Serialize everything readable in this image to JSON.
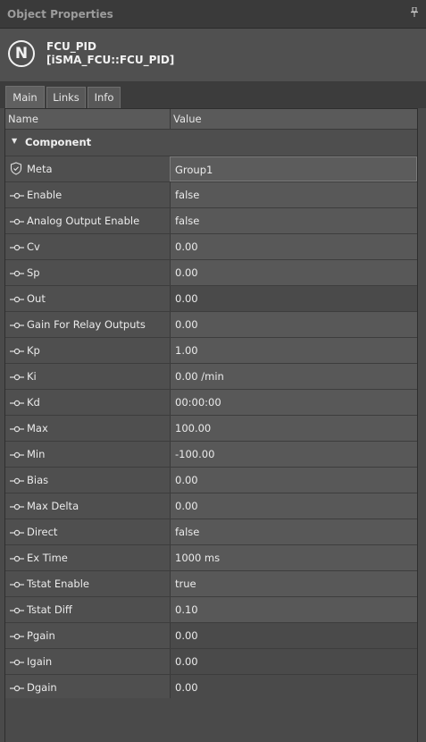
{
  "window": {
    "title": "Object Properties",
    "pin_icon": "pin-icon"
  },
  "object": {
    "name": "FCU_PID",
    "type": "[iSMA_FCU::FCU_PID]",
    "logo_letter": "N"
  },
  "tabs": [
    {
      "label": "Main",
      "active": true
    },
    {
      "label": "Links",
      "active": false
    },
    {
      "label": "Info",
      "active": false
    }
  ],
  "columns": {
    "name": "Name",
    "value": "Value"
  },
  "section": {
    "label": "Component"
  },
  "rows": [
    {
      "name": "Meta",
      "value": "Group1",
      "icon": "shield-icon"
    },
    {
      "name": "Enable",
      "value": "false",
      "icon": "slot-icon"
    },
    {
      "name": "Analog Output Enable",
      "value": "false",
      "icon": "slot-icon"
    },
    {
      "name": "Cv",
      "value": "0.00",
      "icon": "slot-icon"
    },
    {
      "name": "Sp",
      "value": "0.00",
      "icon": "slot-icon"
    },
    {
      "name": "Out",
      "value": "0.00",
      "icon": "slot-icon"
    },
    {
      "name": "Gain For Relay Outputs",
      "value": "0.00",
      "icon": "slot-icon"
    },
    {
      "name": "Kp",
      "value": "1.00",
      "icon": "slot-icon"
    },
    {
      "name": "Ki",
      "value": "0.00 /min",
      "icon": "slot-icon"
    },
    {
      "name": "Kd",
      "value": "00:00:00",
      "icon": "slot-icon"
    },
    {
      "name": "Max",
      "value": "100.00",
      "icon": "slot-icon"
    },
    {
      "name": "Min",
      "value": "-100.00",
      "icon": "slot-icon"
    },
    {
      "name": "Bias",
      "value": "0.00",
      "icon": "slot-icon"
    },
    {
      "name": "Max Delta",
      "value": "0.00",
      "icon": "slot-icon"
    },
    {
      "name": "Direct",
      "value": "false",
      "icon": "slot-icon"
    },
    {
      "name": "Ex Time",
      "value": "1000 ms",
      "icon": "slot-icon"
    },
    {
      "name": "Tstat Enable",
      "value": "true",
      "icon": "slot-icon"
    },
    {
      "name": "Tstat Diff",
      "value": "0.10",
      "icon": "slot-icon"
    },
    {
      "name": "Pgain",
      "value": "0.00",
      "icon": "slot-icon"
    },
    {
      "name": "Igain",
      "value": "0.00",
      "icon": "slot-icon"
    },
    {
      "name": "Dgain",
      "value": "0.00",
      "icon": "slot-icon"
    }
  ]
}
